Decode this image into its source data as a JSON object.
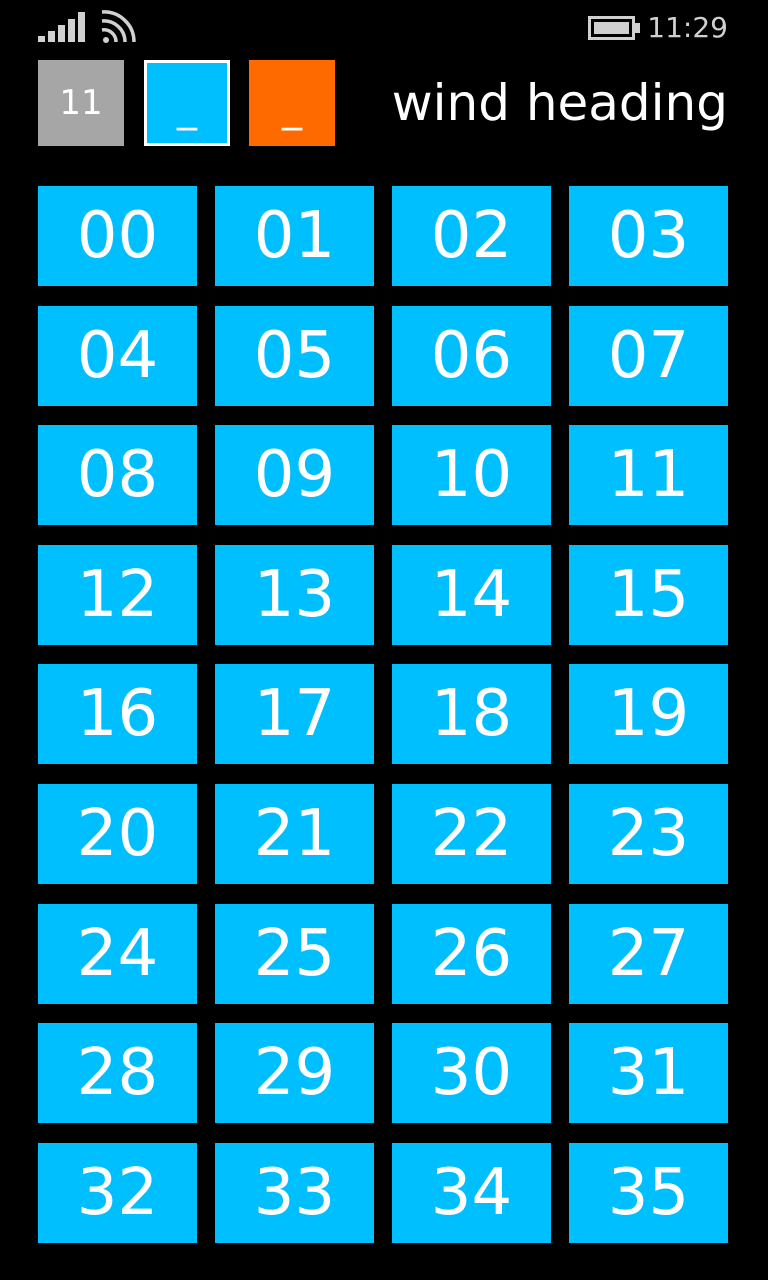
{
  "status_bar": {
    "time": "11:29",
    "icons": [
      "signal-icon",
      "wifi-icon",
      "battery-icon"
    ]
  },
  "header": {
    "gray_box_label": "11",
    "blue_box_label": "_",
    "orange_box_label": "_",
    "title": "wind heading"
  },
  "colors": {
    "background": "#000000",
    "tile": "#00bfff",
    "gray_box": "#a6a6a6",
    "orange_box": "#ff6a00",
    "text": "#ffffff"
  },
  "headings": [
    "00",
    "01",
    "02",
    "03",
    "04",
    "05",
    "06",
    "07",
    "08",
    "09",
    "10",
    "11",
    "12",
    "13",
    "14",
    "15",
    "16",
    "17",
    "18",
    "19",
    "20",
    "21",
    "22",
    "23",
    "24",
    "25",
    "26",
    "27",
    "28",
    "29",
    "30",
    "31",
    "32",
    "33",
    "34",
    "35"
  ]
}
